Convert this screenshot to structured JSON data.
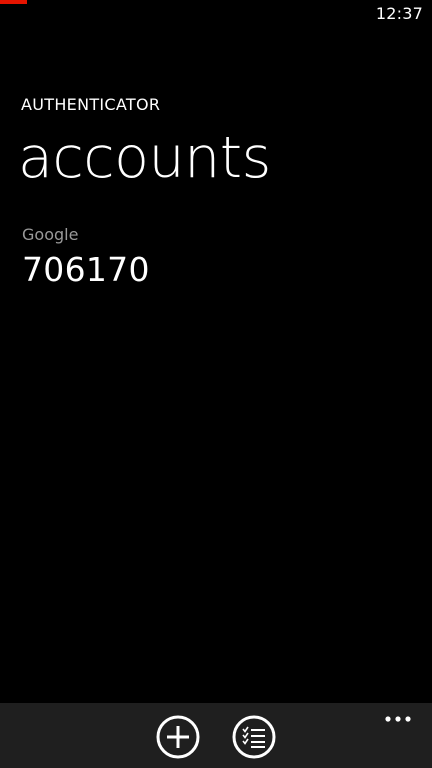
{
  "status_bar": {
    "time": "12:37"
  },
  "header": {
    "app_title": "AUTHENTICATOR",
    "page_title": "accounts"
  },
  "accounts": [
    {
      "name": "Google",
      "code": "706170"
    }
  ],
  "app_bar": {
    "buttons": [
      {
        "icon": "add-icon"
      },
      {
        "icon": "select-list-icon"
      }
    ],
    "more_icon": "ellipsis-icon"
  },
  "colors": {
    "background": "#000000",
    "accent": "#e51400",
    "app_bar": "#1f1f1f",
    "secondary_text": "#999999"
  }
}
